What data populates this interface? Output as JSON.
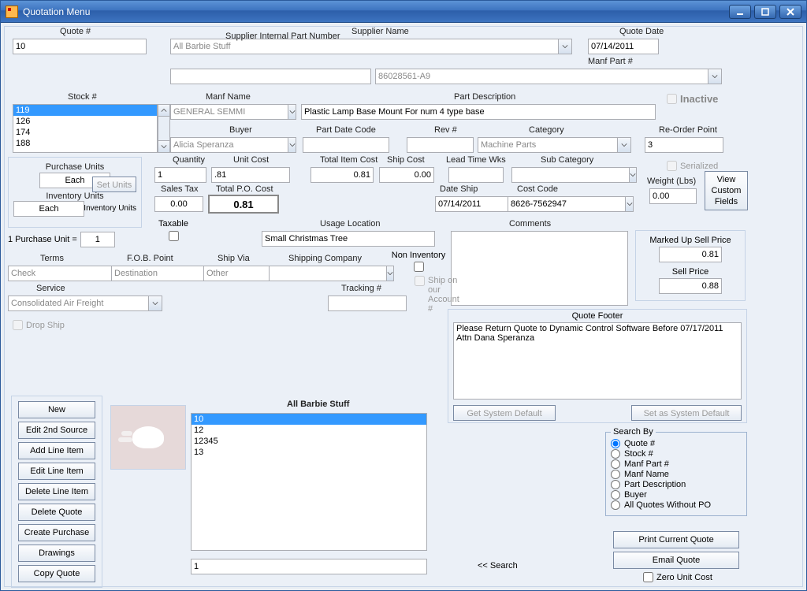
{
  "window": {
    "title": "Quotation  Menu"
  },
  "header": {
    "quote_num_label": "Quote #",
    "quote_num": "10",
    "supplier_name_label": "Supplier Name",
    "supplier_name": "All Barbie Stuff",
    "quote_date_label": "Quote Date",
    "quote_date": "07/14/2011",
    "sup_int_part_label": "Supplier Internal Part Number",
    "sup_int_part": "",
    "manf_part_label": "Manf Part #",
    "manf_part": "86028561-A9"
  },
  "stock": {
    "label": "Stock #",
    "items": [
      "119",
      "126",
      "174",
      "188"
    ],
    "selected": "119"
  },
  "row2": {
    "manf_name_label": "Manf Name",
    "manf_name": "GENERAL SEMMI",
    "part_desc_label": "Part Description",
    "part_desc": "Plastic Lamp Base Mount For num 4 type base",
    "inactive_label": "Inactive"
  },
  "row3": {
    "buyer_label": "Buyer",
    "buyer": "Alicia Speranza",
    "part_date_label": "Part Date Code",
    "part_date": "",
    "rev_label": "Rev #",
    "rev": "",
    "category_label": "Category",
    "category": "Machine Parts",
    "reorder_label": "Re-Order Point",
    "reorder": "3"
  },
  "units_group": {
    "purchase_units_label": "Purchase Units",
    "purchase_units": "Each",
    "inventory_units_label": "Inventory Units",
    "inventory_units": "Each",
    "set_units_btn": "Set Units",
    "inv_units2_label": "Inventory Units",
    "equation_left": "1 Purchase Unit =",
    "equation_val": "1"
  },
  "row4": {
    "quantity_label": "Quantity",
    "quantity": "1",
    "unit_cost_label": "Unit Cost",
    "unit_cost": ".81",
    "total_item_label": "Total Item Cost",
    "total_item": "0.81",
    "ship_cost_label": "Ship Cost",
    "ship_cost": "0.00",
    "lead_time_label": "Lead Time Wks",
    "lead_time": "",
    "subcat_label": "Sub Category",
    "subcat": "",
    "serialized_label": "Serialized"
  },
  "row5": {
    "sales_tax_label": "Sales Tax",
    "sales_tax": "0.00",
    "total_po_label": "Total P.O. Cost",
    "total_po": "0.81",
    "date_ship_label": "Date Ship",
    "date_ship": "07/14/2011",
    "cost_code_label": "Cost Code",
    "cost_code": "8626-7562947",
    "weight_label": "Weight (Lbs)",
    "weight": "0.00",
    "view_custom_btn": "View Custom Fields"
  },
  "row6": {
    "taxable_label": "Taxable",
    "usage_label": "Usage Location",
    "usage": "Small Christmas Tree",
    "comments_label": "Comments",
    "comments": ""
  },
  "row7": {
    "terms_label": "Terms",
    "terms": "Check",
    "fob_label": "F.O.B. Point",
    "fob": "Destination",
    "shipvia_label": "Ship Via",
    "shipvia": "Other",
    "shipco_label": "Shipping Company",
    "shipco": "",
    "noninv_label": "Non Inventory",
    "shipon_label": "Ship on our Account #",
    "markup_label": "Marked Up Sell Price",
    "markup": "0.81",
    "sell_label": "Sell Price",
    "sell": "0.88"
  },
  "row8": {
    "service_label": "Service",
    "service": "Consolidated Air Freight",
    "tracking_label": "Tracking #",
    "tracking": "",
    "dropship_label": "Drop Ship"
  },
  "footer": {
    "label": "Quote Footer",
    "text": "Please Return Quote to Dynamic Control Software Before 07/17/2011\nAttn Dana Speranza",
    "get_default": "Get System Default",
    "set_default": "Set as System Default"
  },
  "buttons": {
    "new": "New",
    "edit2nd": "Edit 2nd  Source",
    "addline": "Add Line Item",
    "editline": "Edit Line Item",
    "delline": "Delete Line Item",
    "delquote": "Delete Quote",
    "createpo": "Create Purchase",
    "drawings": "Drawings",
    "copyquote": "Copy Quote"
  },
  "midlist": {
    "title": "All Barbie Stuff",
    "items": [
      "10",
      "12",
      "12345",
      "13"
    ],
    "selected": "10",
    "search_val": "1",
    "search_btn": "<< Search"
  },
  "search_by": {
    "legend": "Search By",
    "opts": [
      "Quote #",
      "Stock #",
      "Manf Part #",
      "Manf Name",
      "Part Description",
      "Buyer",
      "All Quotes Without PO"
    ],
    "selected": 0
  },
  "bottom_btns": {
    "print": "Print Current Quote",
    "email": "Email Quote",
    "zero": "Zero Unit Cost"
  }
}
